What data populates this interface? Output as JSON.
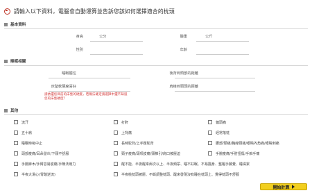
{
  "header": {
    "title": "請輸入以下資料，電腦會自動運算並告訴您該如何選擇適合的枕頭"
  },
  "basic": {
    "title": "基本資料",
    "height_label": "身高",
    "height_unit": "公分",
    "weight_label": "體重",
    "weight_unit": "公斤",
    "gender_label": "性別",
    "age_label": "年齡"
  },
  "sleep": {
    "title": "睡眠相關",
    "posture_label": "睡眠體位",
    "back_head_label": "後背到頭部的距離",
    "mattress_label": "床墊軟硬度喜好",
    "shoulder_label": "肩峰到頸頭的距離",
    "note": "請依還您目前的床墊的硬度，若無法確定請選擇中還不知道您的床墊硬度？"
  },
  "other": {
    "title": "其他",
    "items": [
      "流汗",
      "打鼾",
      "偏頭痛",
      "五十肩",
      "上背痛",
      "經常落枕",
      "睡眠時吸中止",
      "長時駝背/上手壓駝背",
      "腰部/頸痛/胸線頸痛/眼睛內角痛/眼睛刺痛",
      "頭部痠痛/耳朵發炎/下頸不舒服",
      "頸子痠痛/頭項皮痛/頸椎引/肩口被壓迫",
      "手腕痠痛/手肘扭傷/手痲手痛",
      "手腕麻木/手臂容易痠痛/手無法用力",
      "醒不能、半夜醒來兩次以上、半夜頻尿、睡不好眠、不易翻身、整醒手腳覺、睡得累",
      "半夜大滑心(胃酸逆流)",
      "半夜桃枕頭被壓、不斷調整枕頭、醒來發現沒有睡在枕頭上、覺得枕頭不舒服"
    ]
  },
  "submit": {
    "label": "開始計算"
  }
}
